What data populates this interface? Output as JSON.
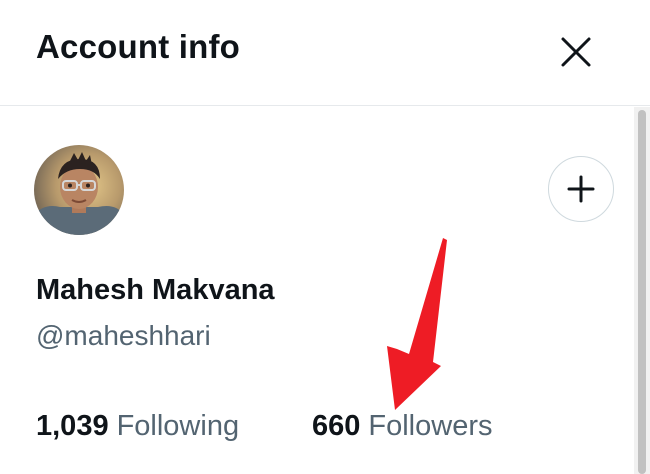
{
  "header": {
    "title": "Account info",
    "close_icon": "close-icon"
  },
  "profile": {
    "avatar_icon": "avatar",
    "follow_icon": "plus-icon",
    "display_name": "Mahesh Makvana",
    "handle": "@maheshhari"
  },
  "stats": {
    "following_count": "1,039",
    "following_label": "Following",
    "followers_count": "660",
    "followers_label": "Followers"
  },
  "annotation": {
    "arrow_color": "#ee1c25"
  },
  "colors": {
    "primary_text": "#0f1419",
    "secondary_text": "#536471",
    "divider": "#e6e9ec"
  }
}
